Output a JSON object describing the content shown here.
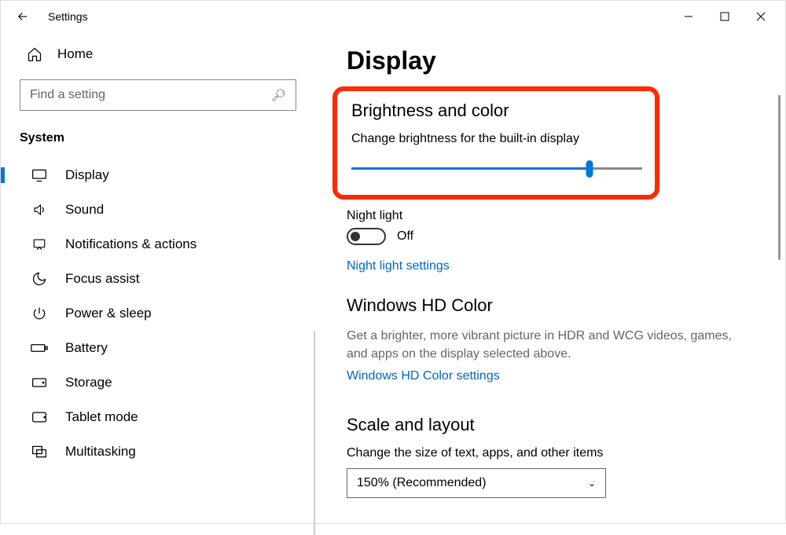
{
  "window": {
    "title": "Settings"
  },
  "sidebar": {
    "home_label": "Home",
    "search_placeholder": "Find a setting",
    "category": "System",
    "items": [
      {
        "icon": "display",
        "label": "Display",
        "selected": true
      },
      {
        "icon": "sound",
        "label": "Sound"
      },
      {
        "icon": "notify",
        "label": "Notifications & actions"
      },
      {
        "icon": "focus",
        "label": "Focus assist"
      },
      {
        "icon": "power",
        "label": "Power & sleep"
      },
      {
        "icon": "battery",
        "label": "Battery"
      },
      {
        "icon": "storage",
        "label": "Storage"
      },
      {
        "icon": "tablet",
        "label": "Tablet mode"
      },
      {
        "icon": "multitask",
        "label": "Multitasking"
      }
    ]
  },
  "main": {
    "page_title": "Display",
    "brightness": {
      "heading": "Brightness and color",
      "desc": "Change brightness for the built-in display",
      "value_percent": 82
    },
    "night_light": {
      "label": "Night light",
      "state": "Off",
      "link": "Night light settings"
    },
    "hd_color": {
      "heading": "Windows HD Color",
      "desc": "Get a brighter, more vibrant picture in HDR and WCG videos, games, and apps on the display selected above.",
      "link": "Windows HD Color settings"
    },
    "scale": {
      "heading": "Scale and layout",
      "desc": "Change the size of text, apps, and other items",
      "dropdown_value": "150% (Recommended)"
    }
  }
}
